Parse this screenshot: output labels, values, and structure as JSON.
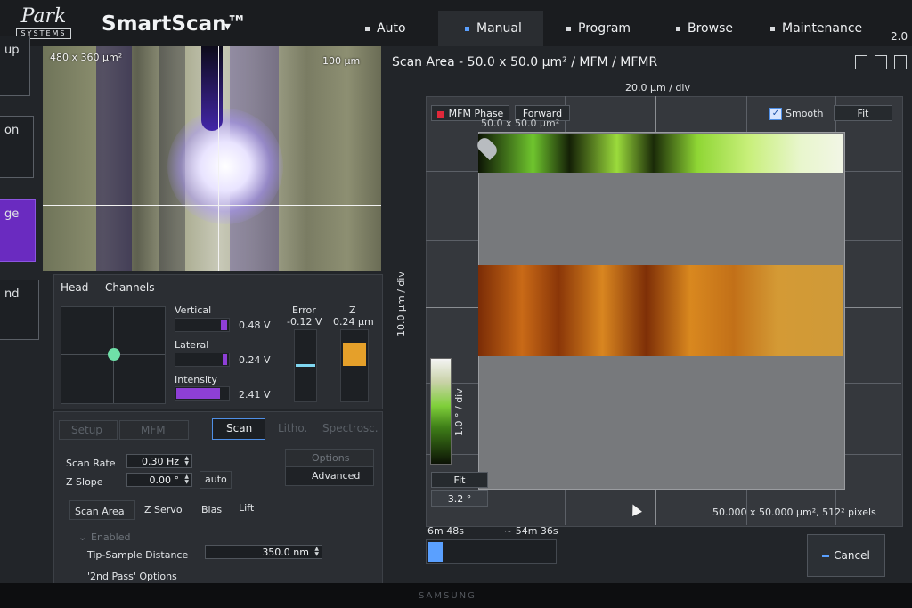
{
  "logo": {
    "line1": "Park",
    "line2": "SYSTEMS"
  },
  "app": {
    "title": "SmartScan™",
    "caret": "▾",
    "version": "2.0"
  },
  "nav": [
    {
      "label": "Auto"
    },
    {
      "label": "Manual"
    },
    {
      "label": "Program"
    },
    {
      "label": "Browse"
    },
    {
      "label": "Maintenance"
    }
  ],
  "left_nav": [
    "up",
    "on",
    "ge",
    "nd"
  ],
  "camera": {
    "area": "480 x 360 μm²",
    "scale": "100 μm"
  },
  "head_panel": {
    "tabs": [
      "Head",
      "Channels"
    ],
    "vertical": {
      "label": "Vertical",
      "value": "0.48 V"
    },
    "lateral": {
      "label": "Lateral",
      "value": "0.24 V"
    },
    "intensity": {
      "label": "Intensity",
      "value": "2.41 V"
    },
    "error": {
      "label": "Error",
      "value": "-0.12 V"
    },
    "z": {
      "label": "Z",
      "value": "0.24 μm"
    },
    "levels": {
      "vertical": 0.12,
      "lateral": 0.08,
      "intensity": 0.85,
      "z": 0.65
    }
  },
  "scan_panel": {
    "tabs": [
      "Setup",
      "MFM",
      "Scan",
      "Litho.",
      "Spectrosc."
    ],
    "options_label": "Options",
    "advanced_label": "Advanced",
    "scan_rate": {
      "label": "Scan Rate",
      "value": "0.30 Hz"
    },
    "z_slope": {
      "label": "Z Slope",
      "value": "0.00 °",
      "auto": "auto"
    },
    "subtabs": [
      "Scan Area",
      "Z Servo",
      "Bias",
      "Lift"
    ],
    "enabled": "Enabled",
    "tip_sample": {
      "label": "Tip-Sample Distance",
      "value": "350.0 nm"
    },
    "second_pass": "'2nd Pass' Options"
  },
  "scan_area": {
    "title": "Scan Area  -  50.0 x 50.0 μm² / MFM / MFMR",
    "x_div": "20.0 μm / div",
    "y_div": "10.0 μm / div",
    "channel": "MFM Phase",
    "direction": "Forward",
    "smooth": "Smooth",
    "fit": "Fit",
    "overlay": "50.0 x 50.0 μm²",
    "colorbar_label": "1.0 ° / div",
    "colorbar_fit": "Fit",
    "colorbar_value": "3.2 °",
    "footer": "50.000 x 50.000 μm², 512² pixels"
  },
  "progress": {
    "elapsed": "6m 48s",
    "remaining": "~ 54m 36s",
    "fraction": 0.11
  },
  "cancel_label": "Cancel",
  "monitor": {
    "brand": "SAMSUNG"
  }
}
